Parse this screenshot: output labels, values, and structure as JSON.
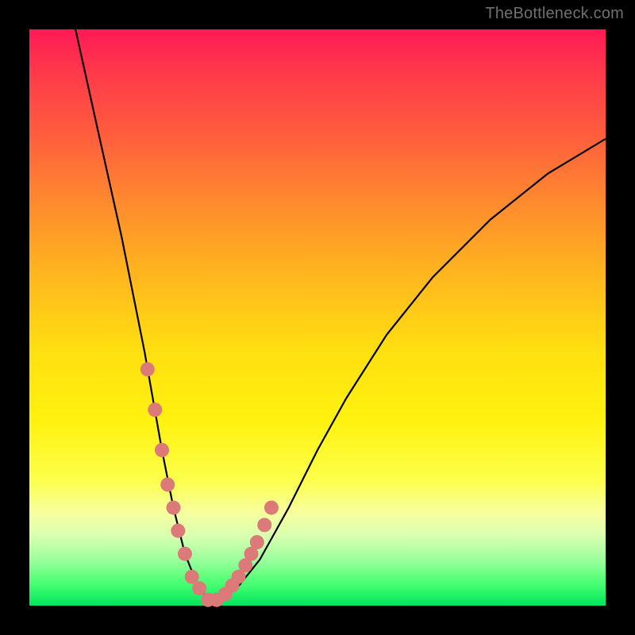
{
  "watermark": "TheBottleneck.com",
  "colors": {
    "frame": "#000000",
    "curve": "#000000",
    "marker": "#db7a78",
    "gradient_stops": [
      {
        "pct": 0,
        "hex": "#ff1a55"
      },
      {
        "pct": 8,
        "hex": "#ff3b4a"
      },
      {
        "pct": 18,
        "hex": "#ff5c3e"
      },
      {
        "pct": 30,
        "hex": "#ff8a2e"
      },
      {
        "pct": 42,
        "hex": "#ffb41f"
      },
      {
        "pct": 56,
        "hex": "#ffe010"
      },
      {
        "pct": 68,
        "hex": "#fff210"
      },
      {
        "pct": 78,
        "hex": "#fcff4a"
      },
      {
        "pct": 84,
        "hex": "#f7ffa0"
      },
      {
        "pct": 88,
        "hex": "#d8ffb0"
      },
      {
        "pct": 92,
        "hex": "#9cff9c"
      },
      {
        "pct": 96,
        "hex": "#4cff74"
      },
      {
        "pct": 100,
        "hex": "#00e65c"
      }
    ]
  },
  "chart_data": {
    "type": "line",
    "title": "",
    "xlabel": "",
    "ylabel": "",
    "xlim": [
      0,
      100
    ],
    "ylim": [
      0,
      100
    ],
    "grid": false,
    "legend": false,
    "series": [
      {
        "name": "bottleneck-curve",
        "x": [
          8,
          12,
          16,
          20,
          23,
          25,
          27,
          29,
          31,
          33,
          36,
          40,
          45,
          50,
          55,
          62,
          70,
          80,
          90,
          100
        ],
        "y": [
          100,
          82,
          64,
          44,
          27,
          17,
          9,
          4,
          1,
          1,
          3,
          8,
          17,
          27,
          36,
          47,
          57,
          67,
          75,
          81
        ]
      }
    ],
    "markers": {
      "name": "highlight-points",
      "x": [
        20.5,
        21.8,
        23.0,
        24.0,
        25.0,
        25.8,
        27.0,
        28.2,
        29.5,
        31.0,
        32.5,
        34.0,
        35.2,
        36.3,
        37.5,
        38.5,
        39.5,
        40.8,
        42.0
      ],
      "y": [
        41,
        34,
        27,
        21,
        17,
        13,
        9,
        5,
        3,
        1,
        1,
        2,
        3.5,
        5,
        7,
        9,
        11,
        14,
        17
      ]
    }
  }
}
